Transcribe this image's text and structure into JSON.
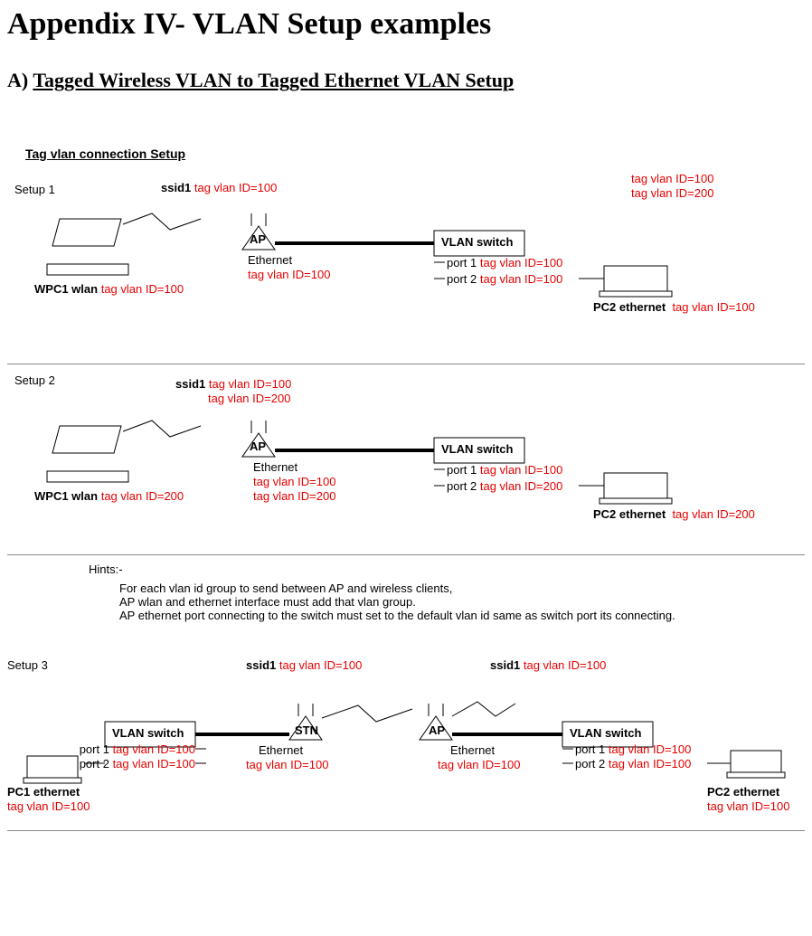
{
  "header": {
    "title": "Appendix IV- VLAN Setup examples",
    "section_prefix": "A) ",
    "section": "Tagged Wireless VLAN to Tagged Ethernet VLAN Setup"
  },
  "diagram": {
    "title": "Tag vlan connection Setup",
    "setup1": {
      "label": "Setup 1",
      "ssid": "ssid1",
      "ssid_tag": "tag vlan ID=100",
      "wpc1": "WPC1 wlan",
      "wpc1_tag": "tag vlan ID=100",
      "ap": "AP",
      "eth": "Ethernet",
      "eth_tag": "tag vlan ID=100",
      "vswitch": "VLAN switch",
      "port1": "port 1",
      "port1_tag": "tag vlan ID=100",
      "port2": "port 2",
      "port2_tag": "tag vlan ID=100",
      "pc2": "PC2 ethernet",
      "pc2_tag": "tag vlan ID=100",
      "top_tag1": "tag vlan ID=100",
      "top_tag2": "tag vlan ID=200"
    },
    "setup2": {
      "label": "Setup 2",
      "ssid": "ssid1",
      "ssid_tag1": "tag vlan ID=100",
      "ssid_tag2": "tag vlan ID=200",
      "wpc1": "WPC1 wlan",
      "wpc1_tag": "tag vlan ID=200",
      "ap": "AP",
      "eth": "Ethernet",
      "eth_tag1": "tag vlan ID=100",
      "eth_tag2": "tag vlan ID=200",
      "vswitch": "VLAN switch",
      "port1": "port 1",
      "port1_tag": "tag vlan ID=100",
      "port2": "port 2",
      "port2_tag": "tag vlan ID=200",
      "pc2": "PC2 ethernet",
      "pc2_tag": "tag vlan ID=200"
    },
    "hints": {
      "title": "Hints:-",
      "line1": "For each vlan id group to send between AP and wireless clients,",
      "line2": "AP wlan and ethernet interface must add that vlan group.",
      "line3": "AP ethernet port connecting to the switch must set to the default vlan id same as switch port its connecting."
    },
    "setup3": {
      "label": "Setup 3",
      "ssid_l": "ssid1",
      "ssid_l_tag": "tag vlan ID=100",
      "ssid_r": "ssid1",
      "ssid_r_tag": "tag vlan ID=100",
      "vswitch_l": "VLAN switch",
      "vswitch_r": "VLAN switch",
      "stn": "STN",
      "ap": "AP",
      "eth_l": "Ethernet",
      "eth_l_tag": "tag vlan ID=100",
      "eth_r": "Ethernet",
      "eth_r_tag": "tag vlan ID=100",
      "port1_l": "port 1",
      "port1_l_tag": "tag vlan ID=100",
      "port2_l": "port 2",
      "port2_l_tag": "tag vlan ID=100",
      "port1_r": "port 1",
      "port1_r_tag": "tag vlan ID=100",
      "port2_r": "port 2",
      "port2_r_tag": "tag vlan ID=100",
      "pc1": "PC1 ethernet",
      "pc1_tag": "tag vlan ID=100",
      "pc2": "PC2 ethernet",
      "pc2_tag": "tag vlan ID=100"
    }
  }
}
